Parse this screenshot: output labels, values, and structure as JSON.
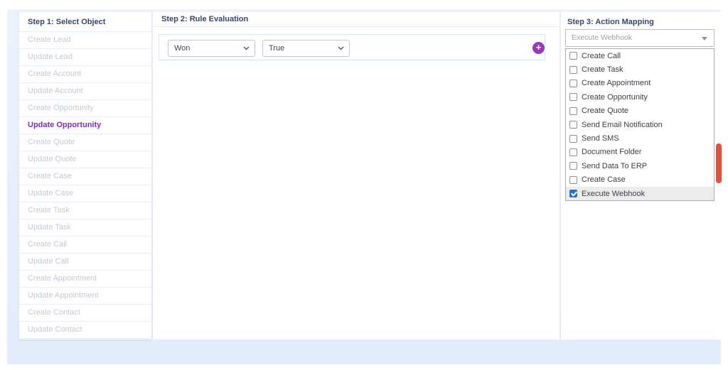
{
  "colors": {
    "accent_purple": "#7b2db8",
    "add_button_purple": "#9d36b6",
    "header_navy": "#33476b",
    "checkbox_checked_blue": "#1a73e8",
    "side_tab_red": "#e2513e"
  },
  "step1": {
    "title": "Step 1: Select Object",
    "items": [
      {
        "label": "Create Lead",
        "selected": false
      },
      {
        "label": "Update Lead",
        "selected": false
      },
      {
        "label": "Create Account",
        "selected": false
      },
      {
        "label": "Update Account",
        "selected": false
      },
      {
        "label": "Create Opportunity",
        "selected": false
      },
      {
        "label": "Update Opportunity",
        "selected": true
      },
      {
        "label": "Create Quote",
        "selected": false
      },
      {
        "label": "Update Quote",
        "selected": false
      },
      {
        "label": "Create Case",
        "selected": false
      },
      {
        "label": "Update Case",
        "selected": false
      },
      {
        "label": "Create Task",
        "selected": false
      },
      {
        "label": "Update Task",
        "selected": false
      },
      {
        "label": "Create Call",
        "selected": false
      },
      {
        "label": "Update Call",
        "selected": false
      },
      {
        "label": "Create Appointment",
        "selected": false
      },
      {
        "label": "Update Appointment",
        "selected": false
      },
      {
        "label": "Create Contact",
        "selected": false
      },
      {
        "label": "Update Contact",
        "selected": false
      }
    ]
  },
  "step2": {
    "title": "Step 2: Rule Evaluation",
    "rule_row": {
      "field_value": "Won",
      "condition_value": "True"
    },
    "add_button_label": "+"
  },
  "step3": {
    "title": "Step 3: Action Mapping",
    "dropdown_value": "Execute Webhook",
    "options": [
      {
        "label": "Create Call",
        "checked": false
      },
      {
        "label": "Create Task",
        "checked": false
      },
      {
        "label": "Create Appointment",
        "checked": false
      },
      {
        "label": "Create Opportunity",
        "checked": false
      },
      {
        "label": "Create Quote",
        "checked": false
      },
      {
        "label": "Send Email Notification",
        "checked": false
      },
      {
        "label": "Send SMS",
        "checked": false
      },
      {
        "label": "Document Folder",
        "checked": false
      },
      {
        "label": "Send Data To ERP",
        "checked": false
      },
      {
        "label": "Create Case",
        "checked": false
      },
      {
        "label": "Execute Webhook",
        "checked": true
      }
    ]
  }
}
